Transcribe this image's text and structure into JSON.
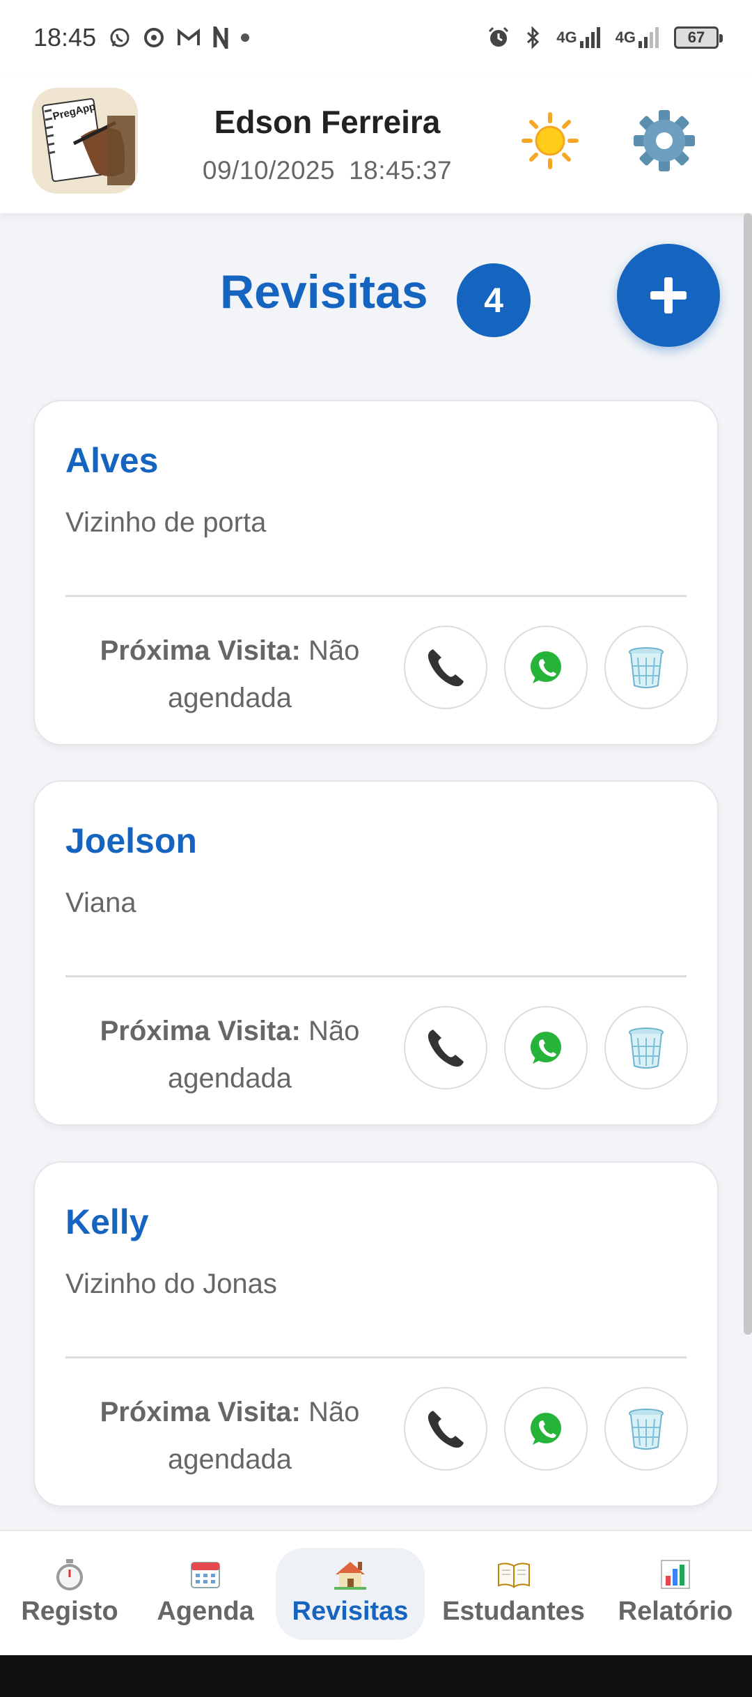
{
  "status_bar": {
    "time": "18:45",
    "network_1": "4G",
    "network_2": "4G",
    "battery": "67"
  },
  "header": {
    "logo_text": "PregApp",
    "user_name": "Edson Ferreira",
    "date": "09/10/2025",
    "time": "18:45:37"
  },
  "page": {
    "title": "Revisitas",
    "count": "4",
    "add_label": "+"
  },
  "cards": [
    {
      "name": "Alves",
      "note": "Vizinho de porta",
      "visit_label": "Próxima Visita:",
      "visit_value": "Não agendada"
    },
    {
      "name": "Joelson",
      "note": "Viana",
      "visit_label": "Próxima Visita:",
      "visit_value": "Não agendada"
    },
    {
      "name": "Kelly",
      "note": "Vizinho do Jonas",
      "visit_label": "Próxima Visita:",
      "visit_value": "Não agendada"
    }
  ],
  "nav": [
    {
      "label": "Registo",
      "icon": "stopwatch-icon"
    },
    {
      "label": "Agenda",
      "icon": "calendar-icon"
    },
    {
      "label": "Revisitas",
      "icon": "house-icon",
      "active": true
    },
    {
      "label": "Estudantes",
      "icon": "book-icon"
    },
    {
      "label": "Relatório",
      "icon": "bar-chart-icon"
    }
  ],
  "colors": {
    "accent": "#1565c0",
    "background": "#f2f4f7",
    "card": "#ffffff",
    "text_muted": "#666666"
  }
}
